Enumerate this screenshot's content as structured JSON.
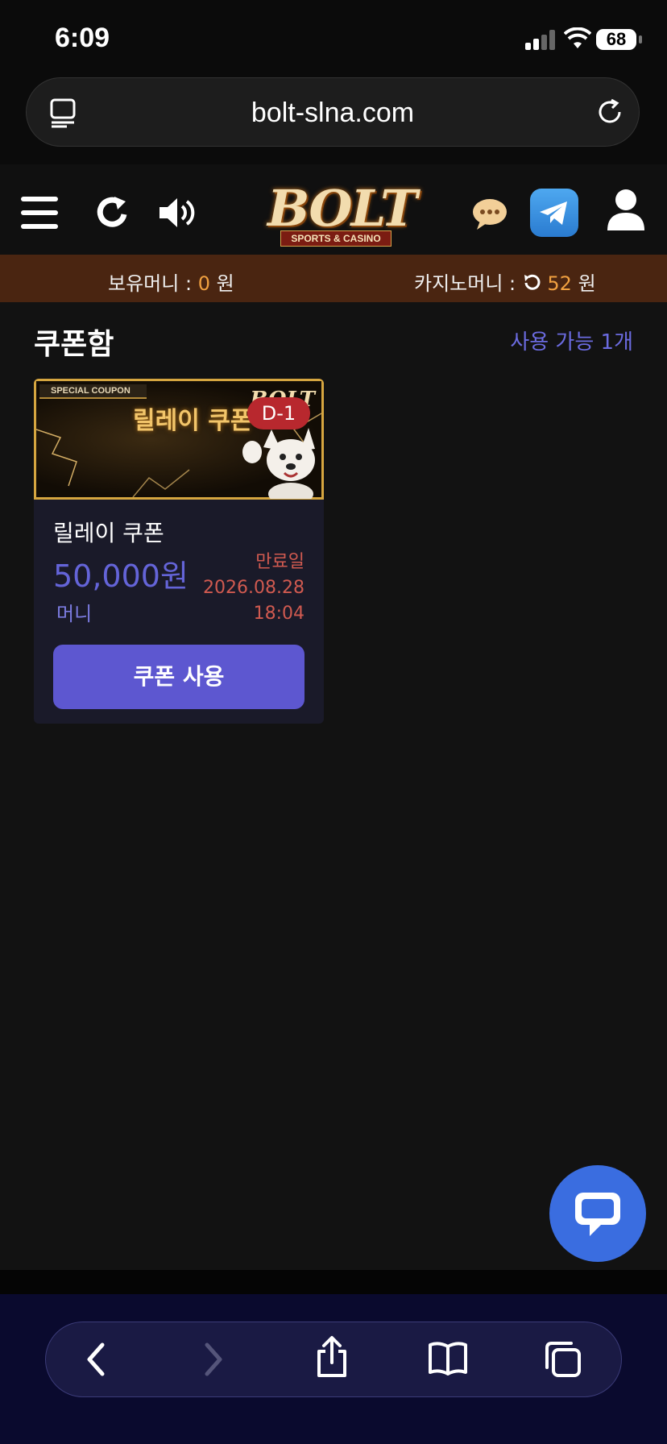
{
  "status_bar": {
    "time": "6:09",
    "battery": "68"
  },
  "browser": {
    "url": "bolt-slna.com"
  },
  "header": {
    "logo_text": "BOLT",
    "logo_subtext": "SPORTS & CASINO",
    "icons": [
      "menu-icon",
      "refresh-icon",
      "speaker-icon",
      "chat-bubble-icon",
      "telegram-icon",
      "user-icon"
    ]
  },
  "money_bar": {
    "held_label": "보유머니 :",
    "held_value": "0",
    "held_unit": "원",
    "casino_label": "카지노머니 :",
    "casino_value": "52",
    "casino_unit": "원"
  },
  "coupons": {
    "title": "쿠폰함",
    "available": "사용 가능 1개",
    "items": [
      {
        "banner_tag": "SPECIAL COUPON",
        "banner_title": "릴레이 쿠폰",
        "banner_logo": "BOLT",
        "dday": "D-1",
        "name": "릴레이 쿠폰",
        "amount": "50,000원",
        "unit": "머니",
        "expiry_label": "만료일",
        "expiry_date": "2026.08.28",
        "expiry_time": "18:04",
        "button": "쿠폰 사용"
      }
    ]
  },
  "colors": {
    "money_bar_bg": "#4a2511",
    "accent": "#5d57d0",
    "expiry": "#d05a50",
    "chat_fab": "#3a6de0"
  },
  "toolbar": {
    "icons": [
      "back-icon",
      "forward-icon",
      "share-icon",
      "bookmarks-icon",
      "tabs-icon"
    ]
  }
}
